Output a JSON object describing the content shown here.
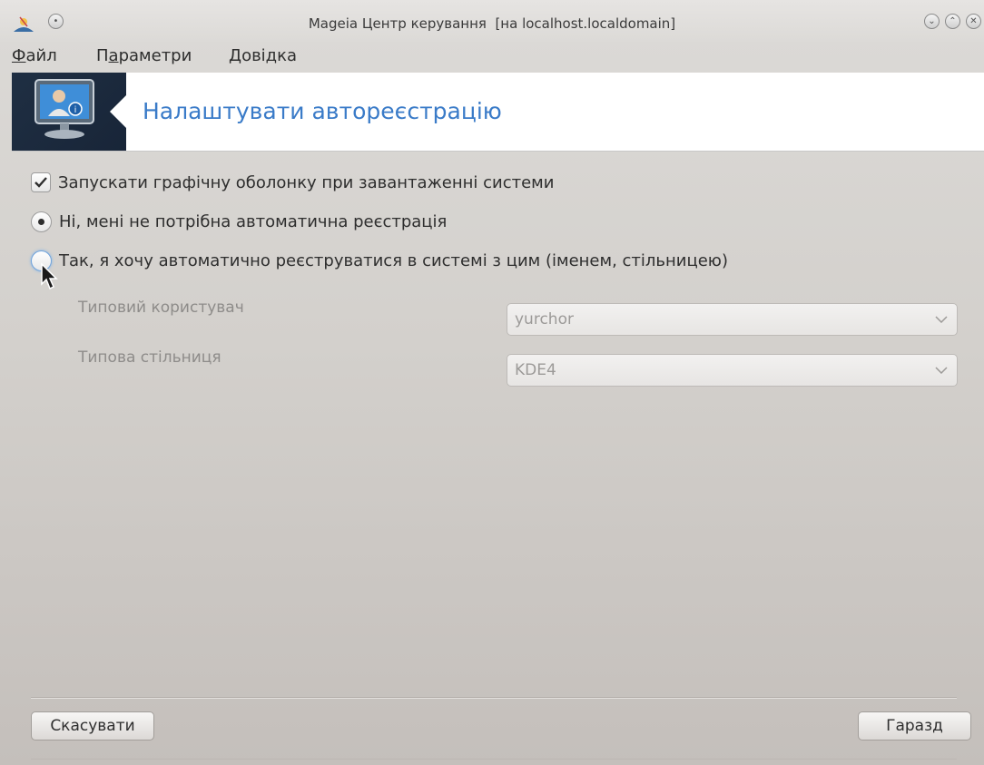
{
  "window": {
    "title": "Mageia Центр керування  [на localhost.localdomain]"
  },
  "menubar": {
    "items": [
      {
        "mnemonic": "Ф",
        "rest": "айл"
      },
      {
        "before": "П",
        "mnemonic": "а",
        "rest": "раметри"
      },
      {
        "mnemonic": "Д",
        "rest": "овідка"
      }
    ]
  },
  "banner": {
    "title": "Налаштувати автореєстрацію",
    "icon": "user-monitor-icon"
  },
  "options": {
    "graphical_boot_label": "Запускати графічну оболонку при завантаженні системи",
    "graphical_boot_checked": true,
    "no_autologin_label": "Ні, мені не потрібна автоматична реєстрація",
    "no_autologin_selected": true,
    "autologin_label": "Так, я хочу автоматично реєструватися в системі з цим (іменем, стільницею)",
    "autologin_selected": false
  },
  "fields": {
    "user_label": "Типовий користувач",
    "user_value": "yurchor",
    "desktop_label": "Типова стільниця",
    "desktop_value": "KDE4"
  },
  "buttons": {
    "cancel": "Скасувати",
    "ok": "Гаразд"
  },
  "colors": {
    "accent": "#3a7bc8",
    "banner_icon_bg": "#1f2f43"
  }
}
